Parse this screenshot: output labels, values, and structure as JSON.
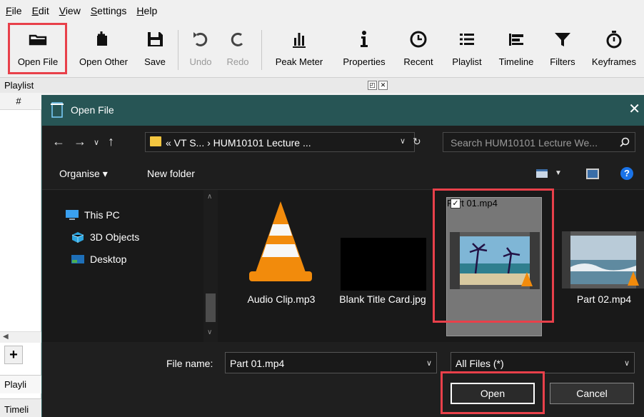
{
  "menu": [
    "File",
    "Edit",
    "View",
    "Settings",
    "Help"
  ],
  "toolbar": {
    "open_file": "Open File",
    "open_other": "Open Other",
    "save": "Save",
    "undo": "Undo",
    "redo": "Redo",
    "peak_meter": "Peak Meter",
    "properties": "Properties",
    "recent": "Recent",
    "playlist": "Playlist",
    "timeline": "Timeline",
    "filters": "Filters",
    "keyframes": "Keyframes"
  },
  "playlist_dock": {
    "title": "Playlist",
    "column": "#",
    "add": "+",
    "tab": "Playli",
    "timeline_tab": "Timeli"
  },
  "dialog": {
    "title": "Open File",
    "address": "« VT S...  ›  HUM10101 Lecture ...",
    "search_placeholder": "Search HUM10101 Lecture We...",
    "organise": "Organise ▾",
    "new_folder": "New folder",
    "help": "?",
    "nav": [
      {
        "label": "This PC"
      },
      {
        "label": "3D Objects"
      },
      {
        "label": "Desktop"
      }
    ],
    "files": [
      {
        "name": "Audio Clip.mp3"
      },
      {
        "name": "Blank Title Card.jpg"
      },
      {
        "name": "Part 01.mp4",
        "selected": true
      },
      {
        "name": "Part 02.mp4"
      }
    ],
    "file_name_label": "File name:",
    "file_name_value": "Part 01.mp4",
    "file_type_value": "All Files (*)",
    "open_button": "Open",
    "cancel_button": "Cancel"
  },
  "colors": {
    "highlight": "#e8404a",
    "dialog_title_bar": "#275555",
    "dialog_bg": "#191919"
  }
}
